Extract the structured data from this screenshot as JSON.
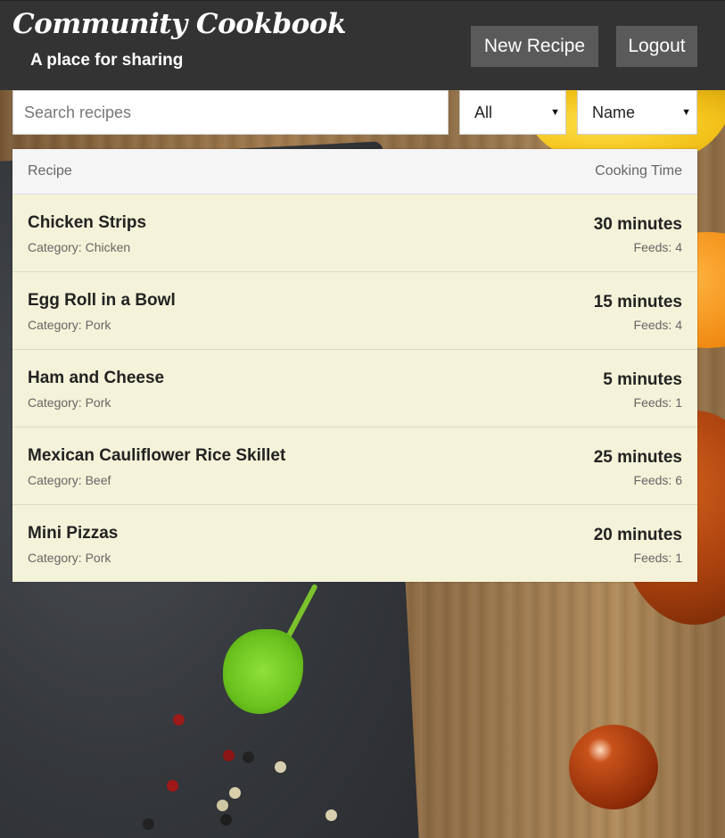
{
  "app": {
    "title": "Community Cookbook",
    "subtitle": "A place for sharing"
  },
  "header": {
    "new_recipe_label": "New Recipe",
    "logout_label": "Logout"
  },
  "search": {
    "placeholder": "Search recipes",
    "value": ""
  },
  "filters": {
    "category_selected": "All",
    "sort_selected": "Name"
  },
  "table": {
    "col_recipe": "Recipe",
    "col_time": "Cooking Time",
    "rows": [
      {
        "name": "Chicken Strips",
        "category": "Category: Chicken",
        "time": "30 minutes",
        "feeds": "Feeds: 4"
      },
      {
        "name": "Egg Roll in a Bowl",
        "category": "Category: Pork",
        "time": "15 minutes",
        "feeds": "Feeds: 4"
      },
      {
        "name": "Ham and Cheese",
        "category": "Category: Pork",
        "time": "5 minutes",
        "feeds": "Feeds: 1"
      },
      {
        "name": "Mexican Cauliflower Rice Skillet",
        "category": "Category: Beef",
        "time": "25 minutes",
        "feeds": "Feeds: 6"
      },
      {
        "name": "Mini Pizzas",
        "category": "Category: Pork",
        "time": "20 minutes",
        "feeds": "Feeds: 1"
      }
    ]
  },
  "colors": {
    "header_bg": "#333333",
    "button_bg": "#5a5a5a",
    "row_bg": "#f4f2d8"
  }
}
